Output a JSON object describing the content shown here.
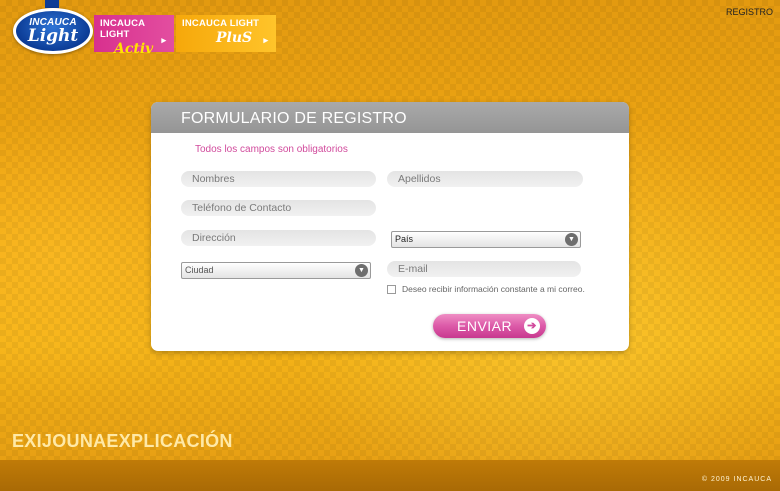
{
  "header": {
    "logo": {
      "top": "INCAUCA",
      "bottom": "Light"
    },
    "promos": [
      {
        "title": "INCAUCA LIGHT",
        "sub": "Activ"
      },
      {
        "title": "INCAUCA LIGHT",
        "sub": "PluS"
      }
    ],
    "top_link": "REGISTRO"
  },
  "form": {
    "title": "FORMULARIO DE REGISTRO",
    "notice": "Todos los campos son obligatorios",
    "fields": {
      "nombres": "Nombres",
      "apellidos": "Apellidos",
      "telefono": "Teléfono de Contacto",
      "direccion": "Dirección",
      "email": "E-mail"
    },
    "selects": {
      "pais": "País",
      "ciudad": "Ciudad"
    },
    "checkbox_label": "Deseo recibir información constante a mi correo.",
    "submit": "ENVIAR"
  },
  "footer": {
    "tagline": "EXIJOUNAEXPLICACIÓN",
    "copyright": "© 2009 INCAUCA"
  },
  "colors": {
    "accent_pink": "#d14a9c",
    "background_orange": "#f0a814",
    "header_gray": "#a0a0a0"
  },
  "icons": [
    "chevron-down-icon",
    "arrow-right-icon"
  ]
}
